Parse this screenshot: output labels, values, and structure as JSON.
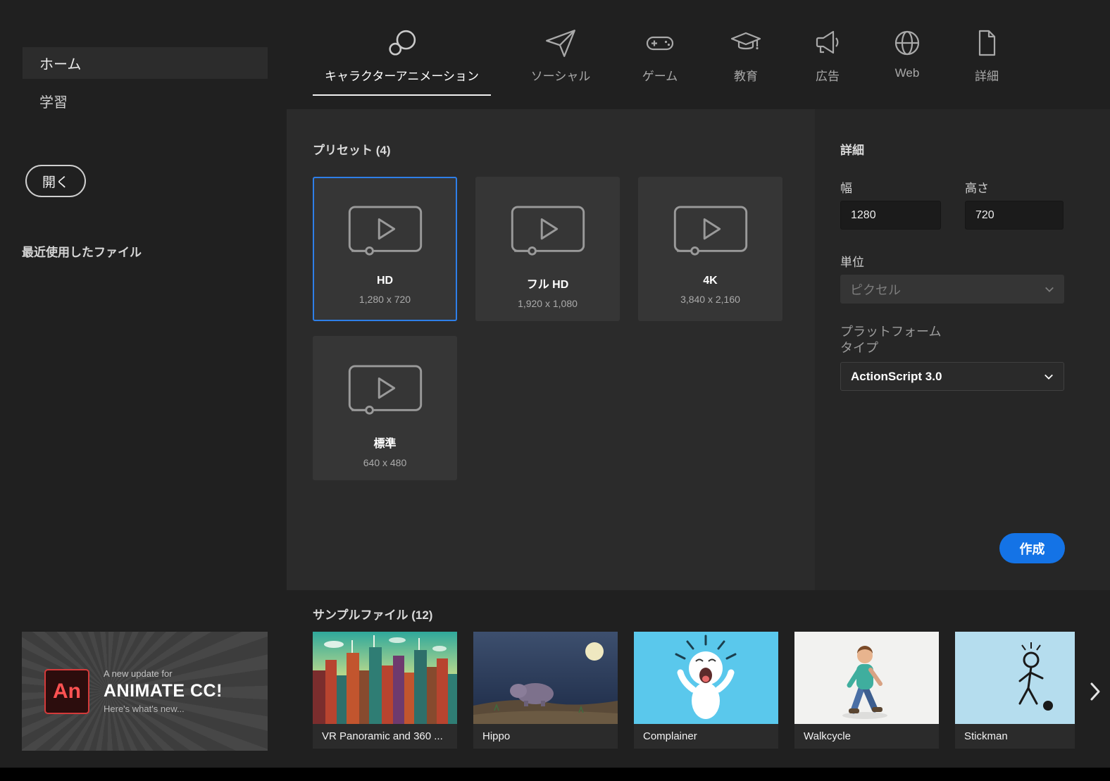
{
  "colors": {
    "accent_blue": "#1473e6",
    "selection_border": "#2e7fe8"
  },
  "sidebar": {
    "home": "ホーム",
    "learn": "学習",
    "open_button": "開く",
    "recent_files": "最近使用したファイル"
  },
  "banner": {
    "logo_text": "An",
    "line1": "A new update for",
    "line2": "ANIMATE CC!",
    "line3": "Here's what's new..."
  },
  "tabs": [
    {
      "label": "キャラクターアニメーション"
    },
    {
      "label": "ソーシャル"
    },
    {
      "label": "ゲーム"
    },
    {
      "label": "教育"
    },
    {
      "label": "広告"
    },
    {
      "label": "Web"
    },
    {
      "label": "詳細"
    }
  ],
  "presets": {
    "title": "プリセット (4)",
    "items": [
      {
        "name": "HD",
        "size": "1,280 x 720"
      },
      {
        "name": "フル HD",
        "size": "1,920 x 1,080"
      },
      {
        "name": "4K",
        "size": "3,840 x 2,160"
      },
      {
        "name": "標準",
        "size": "640 x 480"
      }
    ]
  },
  "details": {
    "title": "詳細",
    "width_label": "幅",
    "width_value": "1280",
    "height_label": "高さ",
    "height_value": "720",
    "units_label": "単位",
    "units_value": "ピクセル",
    "platform_label": "プラットフォームタイプ",
    "platform_value": "ActionScript 3.0",
    "create_button": "作成"
  },
  "samples": {
    "title": "サンプルファイル (12)",
    "items": [
      {
        "label": "VR Panoramic and 360 ..."
      },
      {
        "label": "Hippo"
      },
      {
        "label": "Complainer"
      },
      {
        "label": "Walkcycle"
      },
      {
        "label": "Stickman"
      }
    ]
  }
}
